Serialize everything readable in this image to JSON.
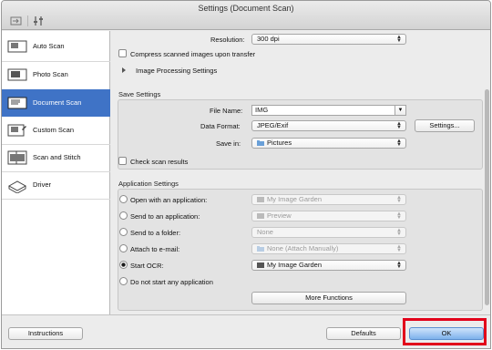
{
  "window": {
    "title": "Settings (Document Scan)"
  },
  "sidebar": {
    "items": [
      {
        "label": "Auto Scan",
        "icon": "auto-scan-icon"
      },
      {
        "label": "Photo Scan",
        "icon": "photo-scan-icon"
      },
      {
        "label": "Document Scan",
        "icon": "document-scan-icon",
        "selected": true
      },
      {
        "label": "Custom Scan",
        "icon": "custom-scan-icon"
      },
      {
        "label": "Scan and Stitch",
        "icon": "scan-and-stitch-icon"
      },
      {
        "label": "Driver",
        "icon": "driver-icon"
      }
    ]
  },
  "scanner_settings": {
    "resolution_label": "Resolution:",
    "resolution_value": "300 dpi",
    "compress_label": "Compress scanned images upon transfer",
    "compress_checked": false,
    "image_processing_label": "Image Processing Settings"
  },
  "save_settings": {
    "title": "Save Settings",
    "file_name_label": "File Name:",
    "file_name_value": "IMG",
    "data_format_label": "Data Format:",
    "data_format_value": "JPEG/Exif",
    "settings_button": "Settings...",
    "save_in_label": "Save in:",
    "save_in_value": "Pictures",
    "check_results_label": "Check scan results",
    "check_results_checked": false
  },
  "app_settings": {
    "title": "Application Settings",
    "options": [
      {
        "label": "Open with an application:",
        "value": "My Image Garden",
        "selected": false,
        "enabled": false
      },
      {
        "label": "Send to an application:",
        "value": "Preview",
        "selected": false,
        "enabled": false
      },
      {
        "label": "Send to a folder:",
        "value": "None",
        "selected": false,
        "enabled": false
      },
      {
        "label": "Attach to e-mail:",
        "value": "None (Attach Manually)",
        "selected": false,
        "enabled": false
      },
      {
        "label": "Start OCR:",
        "value": "My Image Garden",
        "selected": true,
        "enabled": true
      },
      {
        "label": "Do not start any application",
        "selected": false
      }
    ],
    "more_functions_button": "More Functions"
  },
  "footer": {
    "instructions_button": "Instructions",
    "defaults_button": "Defaults",
    "ok_button": "OK"
  },
  "colors": {
    "selection": "#3f73c6",
    "highlight": "#e2001a"
  }
}
